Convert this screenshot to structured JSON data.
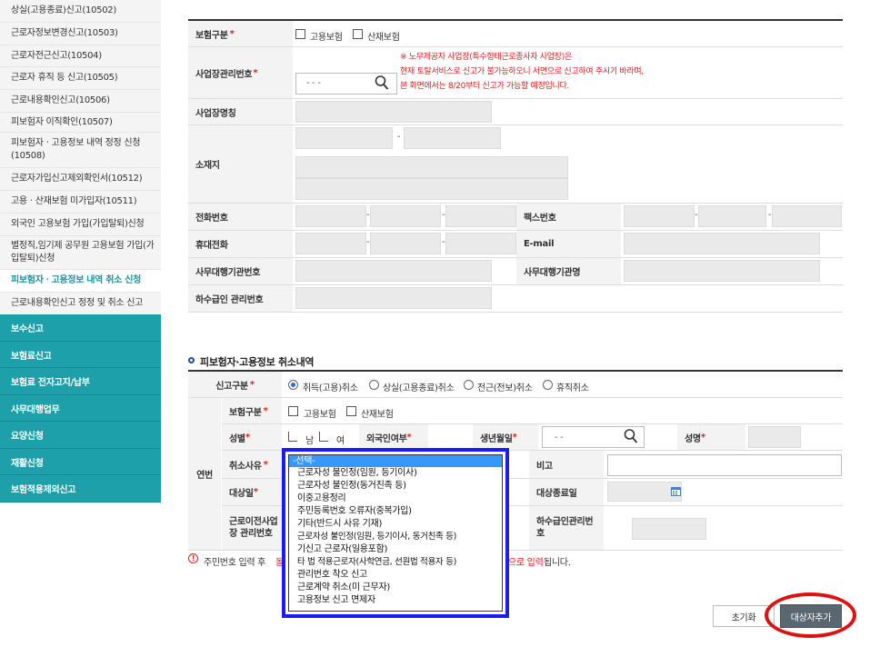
{
  "sidebar": {
    "sub_items": [
      {
        "label": "상실(고용종료)신고(10502)"
      },
      {
        "label": "근로자정보변경신고(10503)"
      },
      {
        "label": "근로자전근신고(10504)"
      },
      {
        "label": "근로자 휴직 등 신고(10505)"
      },
      {
        "label": "근로내용확인신고(10506)"
      },
      {
        "label": "피보험자 이직확인(10507)"
      },
      {
        "label": "피보험자ㆍ고용정보 내역 정정 신청(10508)"
      },
      {
        "label": "근로자가입신고제외확인서(10512)"
      },
      {
        "label": "고용ㆍ산재보험 미가입자(10511)"
      },
      {
        "label": "외국인 고용보험 가입(가입탈퇴)신청"
      },
      {
        "label": "별정직,임기제 공무원 고용보험 가입(가입탈퇴)신청"
      },
      {
        "label": "피보험자ㆍ고용정보 내역 취소 신청"
      },
      {
        "label": "근로내용확인신고 정정 및 취소 신고"
      }
    ],
    "main_items": [
      {
        "label": "보수신고"
      },
      {
        "label": "보험료신고"
      },
      {
        "label": "보험료 전자고지/납부"
      },
      {
        "label": "사무대행업무"
      },
      {
        "label": "요양신청"
      },
      {
        "label": "재활신청"
      },
      {
        "label": "보험적용제외신고"
      }
    ]
  },
  "form1": {
    "insurance_type_label": "보험구분",
    "opt_employment": "고용보험",
    "opt_accident": "산재보험",
    "biz_no_label": "사업장관리번호",
    "biz_no_value": "- -  -",
    "notice_line1": "※ 노무제공자 사업장(특수형태근로종사자 사업장)은",
    "notice_line2": "현재 토탈서비스로 신고가 불가능하오니 서면으로 신고하여 주시기 바라며,",
    "notice_line3": "본 화면에서는 8/20부터 신고가 가능할 예정입니다.",
    "biz_name_label": "사업장명칭",
    "address_label": "소재지",
    "phone_label": "전화번호",
    "fax_label": "팩스번호",
    "mobile_label": "휴대전화",
    "email_label": "E-mail",
    "agency_no_label": "사무대행기관번호",
    "agency_name_label": "사무대행기관명",
    "subcontract_label": "하수급인 관리번호",
    "dash": "-",
    "star": "*"
  },
  "section2": {
    "title": "피보험자·고용정보 취소내역",
    "report_type_label": "신고구분",
    "radio_options": [
      "취득(고용)취소",
      "상실(고용종료)취소",
      "전근(전보)취소",
      "휴직취소"
    ],
    "serial_label": "연번",
    "insurance_type_label": "보험구분",
    "opt_employment": "고용보험",
    "opt_accident": "산재보험",
    "gender_label": "성별",
    "gender_male": "남",
    "gender_female": "여",
    "foreigner_label": "외국인여부",
    "birth_label": "생년월일",
    "birth_value": "- -",
    "name_label": "성명",
    "reason_label": "취소사유",
    "remarks_label": "비고",
    "target_label": "대상일",
    "target_end_label": "대상종료일",
    "prev_biz_label": "근로이전사업장 관리번호",
    "subcontract_label": "하수급인관리번호",
    "warning_prefix": "주민번호 입력 후",
    "warning_red_1": "돌",
    "warning_red_2": "으로 입력",
    "warning_suffix": "됩니다.",
    "reset_btn": "초기화",
    "add_btn": "대상자추가"
  },
  "dropdown": {
    "selected": "-선택-",
    "options": [
      "근로자성 불인정(임원, 등기이사)",
      "근로자성 불인정(동거친족 등)",
      "이중고용정리",
      "주민등록번호 오류자(중복가입)",
      "기타(반드시 사유 기재)",
      "근로자성 불인정(임원, 등기이사, 동거친족 등)",
      "기신고 근로자(일용포함)",
      "타 법 적용근로자(사학연금, 선원법 적용자 등)",
      "관리번호 착오 신고",
      "근로계약 취소(미 근무자)",
      "고용정보 신고 면제자"
    ]
  },
  "colors": {
    "sidebar_teal": "#1ea0aa",
    "active_text": "#1697a6",
    "highlight_blue": "#1a1aff",
    "highlight_red": "#e01010",
    "select_blue": "#3399ff"
  }
}
